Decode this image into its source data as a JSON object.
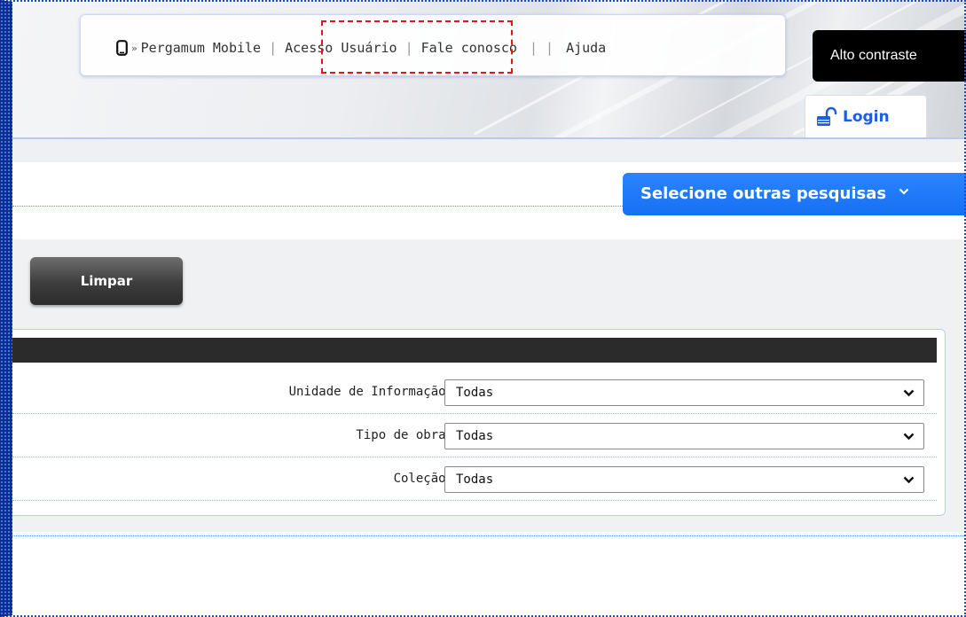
{
  "header": {
    "nav": {
      "mobile_label": "Pergamum Mobile",
      "raquo": "»",
      "items": [
        {
          "label": "Acesso Usuário"
        },
        {
          "label": "Fale conosco"
        },
        {
          "label": "Ajuda"
        }
      ],
      "separators": [
        "|",
        "|",
        "| |"
      ]
    },
    "contrast_label": "Alto contraste",
    "login_label": "Login"
  },
  "search": {
    "select_other_label": "Selecione outras pesquisas"
  },
  "actions": {
    "clear_label": "Limpar"
  },
  "filters": [
    {
      "label": "Unidade de Informação:",
      "value": "Todas"
    },
    {
      "label": "Tipo de obra:",
      "value": "Todas"
    },
    {
      "label": "Coleção:",
      "value": "Todas"
    }
  ],
  "colors": {
    "accent_blue": "#1670f2",
    "link_blue": "#1d5fe0",
    "highlight_red": "#e0161b",
    "frame_blue": "#0f2e8c"
  },
  "icons": {
    "mobile": "mobile-phone-icon",
    "login": "unlock-icon",
    "dropdown": "chevron-down-icon"
  }
}
